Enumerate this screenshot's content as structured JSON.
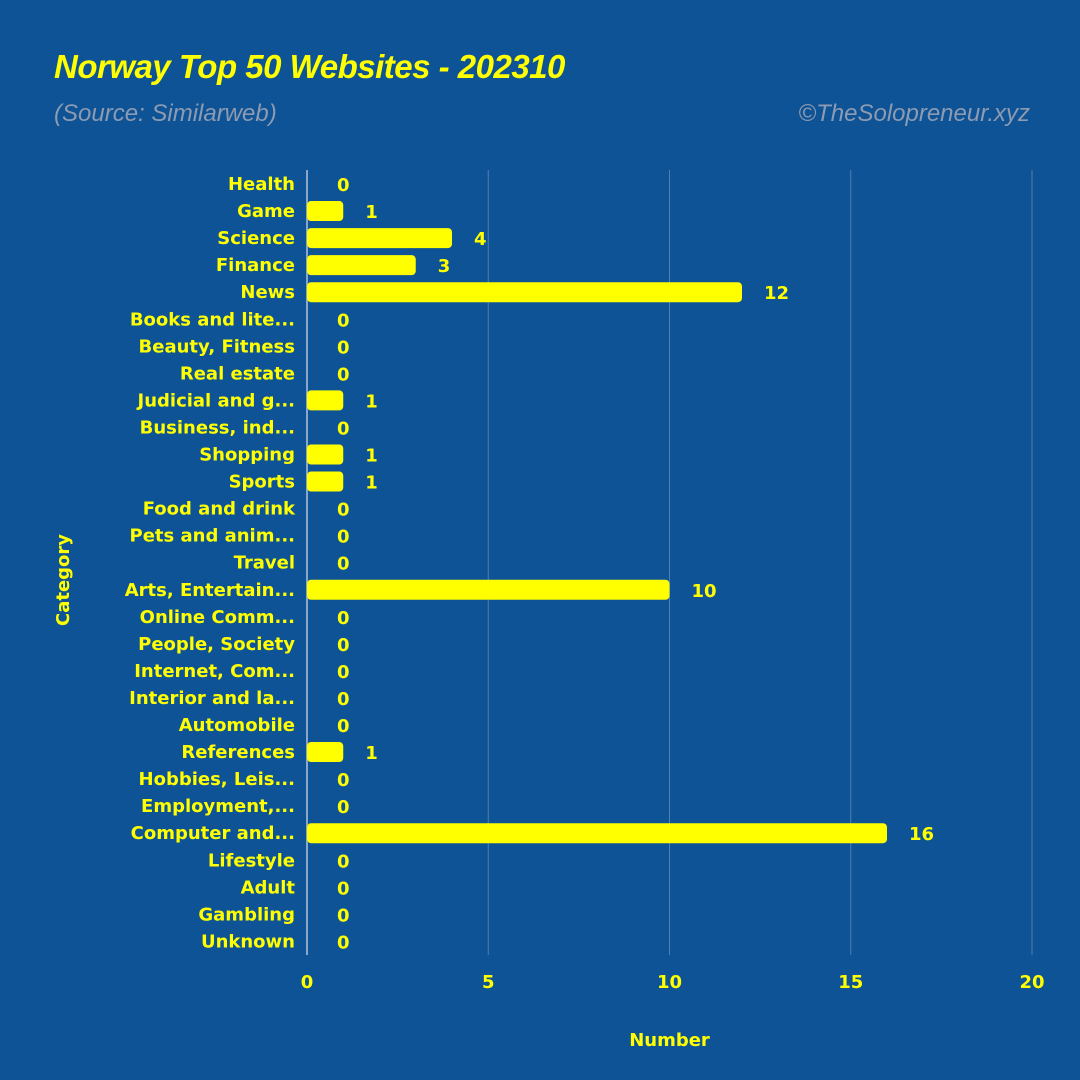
{
  "header": {
    "title": "Norway Top 50 Websites - 202310",
    "subtitle": "(Source: Similarweb)",
    "credit": "©TheSolopreneur.xyz"
  },
  "colors": {
    "background": "#0e5395",
    "bar": "#ffff00",
    "text": "#ffff00",
    "muted_text": "#8c9bb2",
    "grid": "#4f7fb3"
  },
  "chart_data": {
    "type": "bar",
    "orientation": "horizontal",
    "title": "Norway Top 50 Websites - 202310",
    "subtitle": "(Source: Similarweb)",
    "xlabel": "Number",
    "ylabel": "Category",
    "xlim": [
      0,
      20
    ],
    "xticks": [
      0,
      5,
      10,
      15,
      20
    ],
    "grid": true,
    "categories": [
      "Health",
      "Game",
      "Science",
      "Finance",
      "News",
      "Books and lite...",
      "Beauty, Fitness",
      "Real estate",
      "Judicial and g...",
      "Business, ind...",
      "Shopping",
      "Sports",
      "Food and drink",
      "Pets and anim...",
      "Travel",
      "Arts, Entertain...",
      "Online Comm...",
      "People, Society",
      "Internet, Com...",
      "Interior and la...",
      "Automobile",
      "References",
      "Hobbies, Leis...",
      "Employment,...",
      "Computer and...",
      "Lifestyle",
      "Adult",
      "Gambling",
      "Unknown"
    ],
    "values": [
      0,
      1,
      4,
      3,
      12,
      0,
      0,
      0,
      1,
      0,
      1,
      1,
      0,
      0,
      0,
      10,
      0,
      0,
      0,
      0,
      0,
      1,
      0,
      0,
      16,
      0,
      0,
      0,
      0
    ]
  }
}
